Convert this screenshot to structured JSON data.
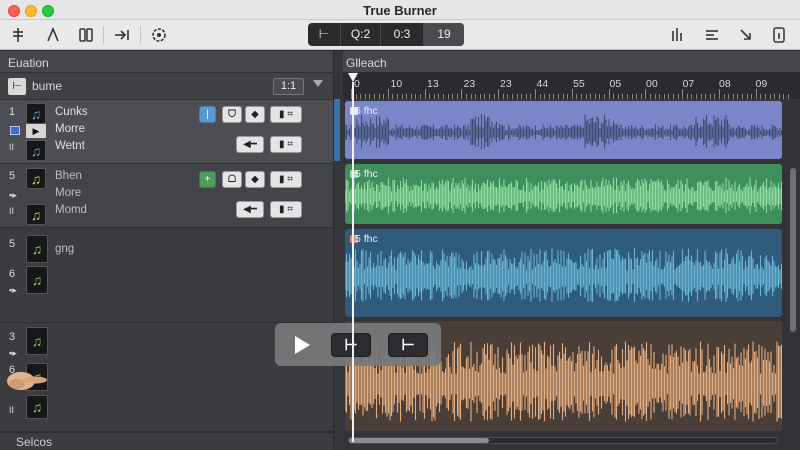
{
  "window": {
    "title": "True Burner"
  },
  "toolbar": {
    "icons_left": [
      "tuning-fork-icon",
      "lambda-icon",
      "split-columns-icon",
      "arrow-into-icon",
      "settings-gear-icon"
    ],
    "lcd": [
      "⊢",
      "Q:2",
      "0:3",
      "19"
    ],
    "icons_right": [
      "levels-icon",
      "align-left-icon",
      "collapse-arrow-icon",
      "info-icon"
    ]
  },
  "left_panel": {
    "header": "Euation",
    "library": {
      "name": "bume",
      "count": "1:1"
    },
    "tracks": [
      {
        "num": "1",
        "lines": [
          "Cunks",
          "Morre",
          "Wetnt"
        ],
        "color": "blue"
      },
      {
        "num": "5",
        "lines": [
          "Bhen",
          "More",
          "Momd"
        ],
        "color": "yellow"
      },
      {
        "num": "5",
        "lines": [
          "gng",
          ""
        ],
        "num2": "6",
        "color": "green"
      },
      {
        "num": "3",
        "lines": [
          "",
          ""
        ],
        "num2": "6",
        "color": "green"
      }
    ],
    "footer": "Selcos"
  },
  "timeline": {
    "header": "Glleach",
    "ruler_labels": [
      "0",
      "10",
      "13",
      "23",
      "23",
      "44",
      "55",
      "05",
      "00",
      "07",
      "08",
      "09"
    ],
    "regions": [
      {
        "label": "6 fhc",
        "color": "#7a86c9",
        "wave": "#3e4f73"
      },
      {
        "label": "5 fhc",
        "color": "#3f8f5c",
        "wave": "#8fdc9f"
      },
      {
        "label": "5 fhc",
        "color": "#2f5b7d",
        "wave": "#69b5d6"
      },
      {
        "label": "",
        "color": "#4a3f38",
        "wave": "#e6ad7f"
      }
    ]
  },
  "transport": {
    "play": "play-icon",
    "btn2": "⊢",
    "btn3": "⊢"
  }
}
